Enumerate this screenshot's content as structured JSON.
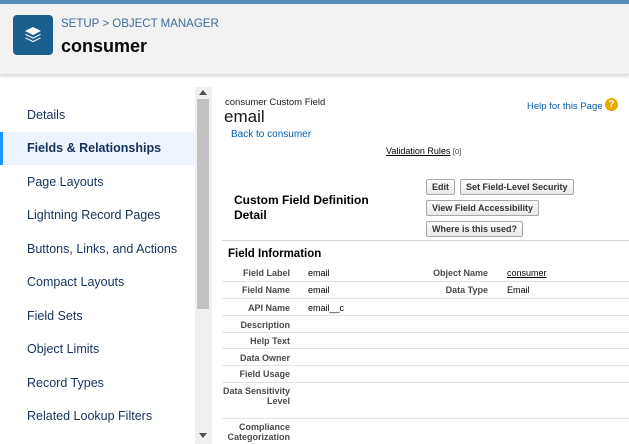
{
  "header": {
    "breadcrumb": [
      "SETUP",
      "OBJECT MANAGER"
    ],
    "breadcrumb_separator": ">",
    "object_title": "consumer",
    "icon": "layers-icon"
  },
  "sidebar": {
    "items": [
      {
        "label": "Details",
        "active": false
      },
      {
        "label": "Fields & Relationships",
        "active": true
      },
      {
        "label": "Page Layouts",
        "active": false
      },
      {
        "label": "Lightning Record Pages",
        "active": false
      },
      {
        "label": "Buttons, Links, and Actions",
        "active": false
      },
      {
        "label": "Compact Layouts",
        "active": false
      },
      {
        "label": "Field Sets",
        "active": false
      },
      {
        "label": "Object Limits",
        "active": false
      },
      {
        "label": "Record Types",
        "active": false
      },
      {
        "label": "Related Lookup Filters",
        "active": false
      }
    ]
  },
  "main": {
    "field_type": "consumer Custom Field",
    "field_title": "email",
    "back_link": "Back to consumer",
    "help_link": "Help for this Page",
    "help_icon": "?",
    "validation_link": "Validation Rules",
    "validation_count": "[0]",
    "definition_title": "Custom Field Definition Detail",
    "buttons": {
      "edit": "Edit",
      "field_level_security": "Set Field-Level Security",
      "view_accessibility": "View Field Accessibility",
      "where_used": "Where is this used?"
    },
    "section_title": "Field Information",
    "fields": [
      {
        "label": "Field Label",
        "value": "email"
      },
      {
        "label": "Field Name",
        "value": "email"
      },
      {
        "label": "API Name",
        "value": "email__c"
      },
      {
        "label": "Description",
        "value": ""
      },
      {
        "label": "Help Text",
        "value": ""
      },
      {
        "label": "Data Owner",
        "value": ""
      },
      {
        "label": "Field Usage",
        "value": ""
      },
      {
        "label": "Data Sensitivity Level",
        "value": ""
      },
      {
        "label": "Compliance Categorization",
        "value": ""
      }
    ],
    "right_fields": [
      {
        "label": "Object Name",
        "value": "consumer"
      },
      {
        "label": "Data Type",
        "value": "Email"
      }
    ]
  },
  "colors": {
    "accent": "#1b96ff",
    "header_icon_bg": "#1b5f8f",
    "link": "#015ba7",
    "active_nav_bg": "#eef4ff"
  }
}
